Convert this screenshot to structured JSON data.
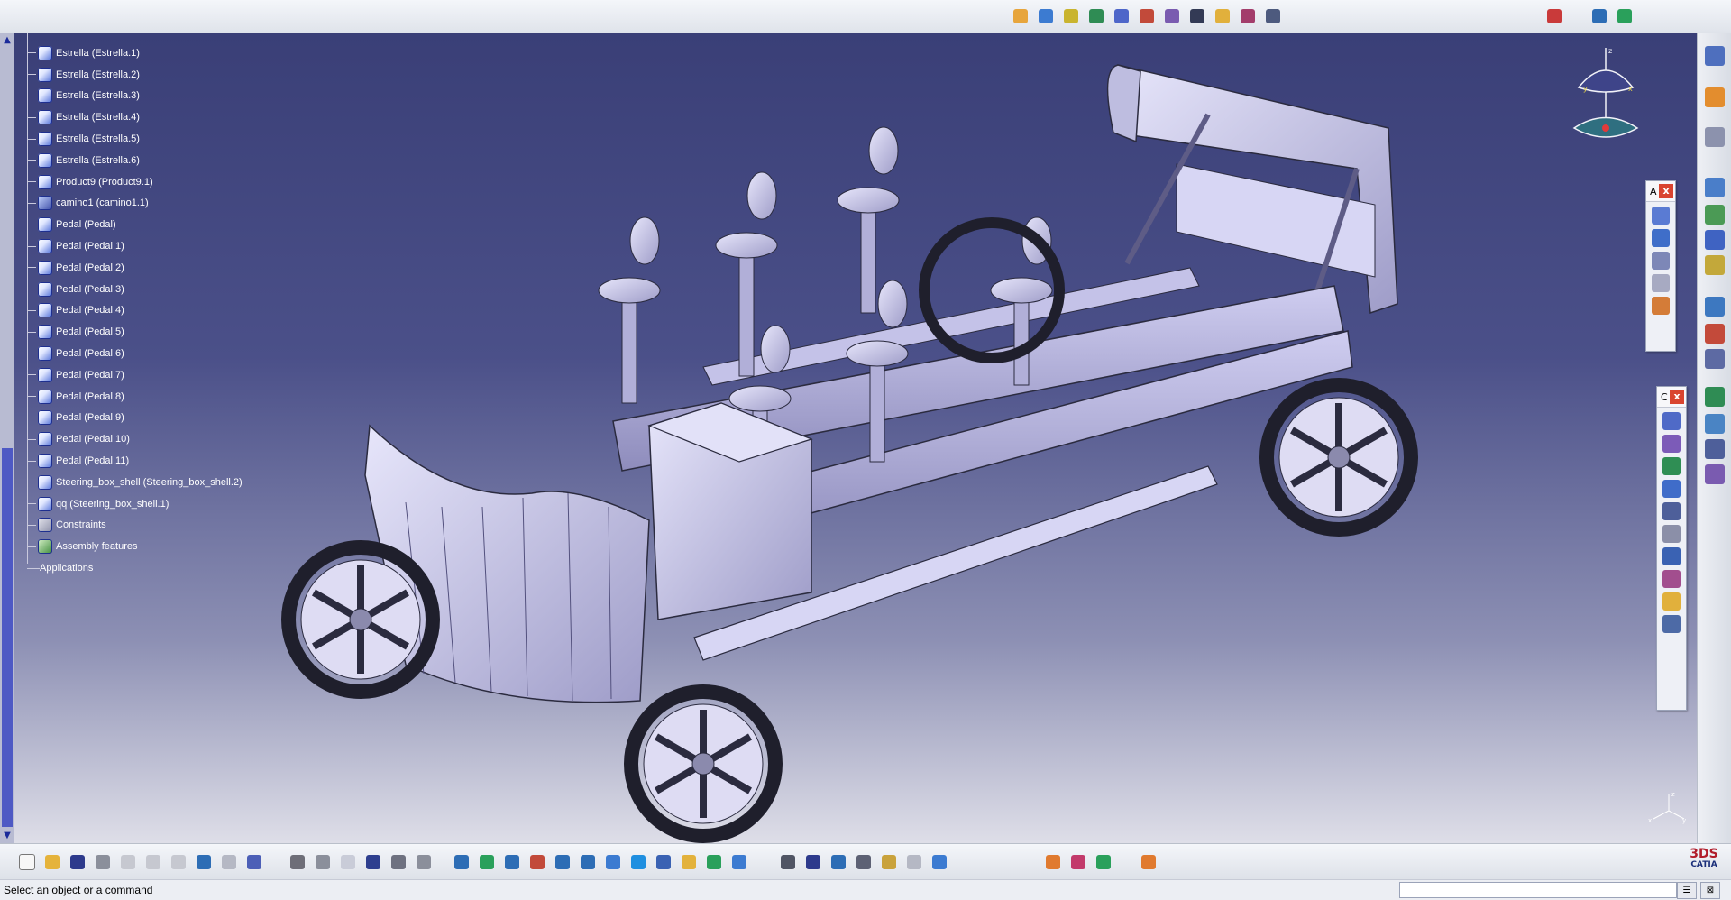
{
  "tree": {
    "items": [
      {
        "label": "Estrella (Estrella.1)",
        "icon": "part-icon"
      },
      {
        "label": "Estrella (Estrella.2)",
        "icon": "part-icon"
      },
      {
        "label": "Estrella (Estrella.3)",
        "icon": "part-icon"
      },
      {
        "label": "Estrella (Estrella.4)",
        "icon": "part-icon"
      },
      {
        "label": "Estrella (Estrella.5)",
        "icon": "part-icon"
      },
      {
        "label": "Estrella (Estrella.6)",
        "icon": "part-icon"
      },
      {
        "label": "Product9 (Product9.1)",
        "icon": "product-icon"
      },
      {
        "label": "camino1 (camino1.1)",
        "icon": "shape-icon"
      },
      {
        "label": "Pedal (Pedal)",
        "icon": "part-icon"
      },
      {
        "label": "Pedal (Pedal.1)",
        "icon": "part-icon"
      },
      {
        "label": "Pedal (Pedal.2)",
        "icon": "part-icon"
      },
      {
        "label": "Pedal (Pedal.3)",
        "icon": "part-icon"
      },
      {
        "label": "Pedal (Pedal.4)",
        "icon": "part-icon"
      },
      {
        "label": "Pedal (Pedal.5)",
        "icon": "part-icon"
      },
      {
        "label": "Pedal (Pedal.6)",
        "icon": "part-icon"
      },
      {
        "label": "Pedal (Pedal.7)",
        "icon": "part-icon"
      },
      {
        "label": "Pedal (Pedal.8)",
        "icon": "part-icon"
      },
      {
        "label": "Pedal (Pedal.9)",
        "icon": "part-icon"
      },
      {
        "label": "Pedal (Pedal.10)",
        "icon": "part-icon"
      },
      {
        "label": "Pedal (Pedal.11)",
        "icon": "part-icon"
      },
      {
        "label": "Steering_box_shell (Steering_box_shell.2)",
        "icon": "part-icon"
      },
      {
        "label": "qq (Steering_box_shell.1)",
        "icon": "part-icon"
      },
      {
        "label": "Constraints",
        "icon": "constraints-icon"
      },
      {
        "label": "Assembly features",
        "icon": "assembly-features-icon"
      },
      {
        "label": "Applications",
        "icon": ""
      }
    ]
  },
  "compass": {
    "x_label": "x",
    "y_label": "y",
    "z_label": "z"
  },
  "floating_panels": {
    "annotation": {
      "title_char": "A",
      "close": "x"
    },
    "constraints": {
      "title_char": "C",
      "close": "x"
    }
  },
  "status": {
    "message": "Select an object or a command",
    "command_value": ""
  },
  "logo": {
    "brand": "CATIA",
    "mark": "3DS"
  },
  "colors": {
    "viewport_top": "#3a3f77",
    "viewport_bottom": "#dedee8",
    "tree_text": "#ffffff",
    "close_button": "#d9442f"
  }
}
